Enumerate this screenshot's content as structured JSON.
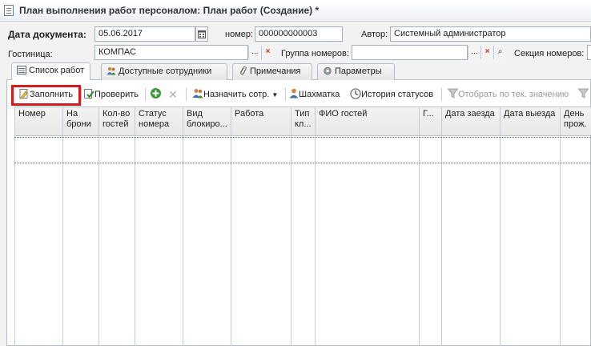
{
  "window": {
    "title": "План выполнения работ персоналом: План работ (Создание) *"
  },
  "header": {
    "date_label": "Дата документа:",
    "date_value": "05.06.2017",
    "number_label": "номер:",
    "number_value": "000000000003",
    "author_label": "Автор:",
    "author_value": "Системный администратор",
    "hotel_label": "Гостиница:",
    "hotel_value": "КОМПАС",
    "room_group_label": "Группа номеров:",
    "room_group_value": "",
    "room_section_label": "Секция номеров:",
    "select_glyph": "...",
    "clear_glyph": "×",
    "search_glyph": "⌕"
  },
  "tabs": [
    {
      "label": "Список работ",
      "icon": "list-icon",
      "active": true
    },
    {
      "label": "Доступные сотрудники",
      "icon": "users-icon",
      "active": false
    },
    {
      "label": "Примечания",
      "icon": "paperclip-icon",
      "active": false
    },
    {
      "label": "Параметры",
      "icon": "gear-icon",
      "active": false
    }
  ],
  "toolbar": {
    "fill_label": "Заполнить",
    "check_label": "Проверить",
    "assign_label": "Назначить сотр.",
    "chess_label": "Шахматка",
    "history_label": "История статусов",
    "filter_label": "Отобрать по тек. значению"
  },
  "grid": {
    "columns": [
      "Номер",
      "На брони",
      "Кол-во гостей",
      "Статус номера",
      "Вид блокиро...",
      "Работа",
      "Тип кл...",
      "ФИО гостей",
      "Г...",
      "Дата заезда",
      "Дата выезда",
      "День прож."
    ]
  },
  "colors": {
    "highlight": "#d31b1b",
    "accent_green": "#3a9a3a"
  }
}
